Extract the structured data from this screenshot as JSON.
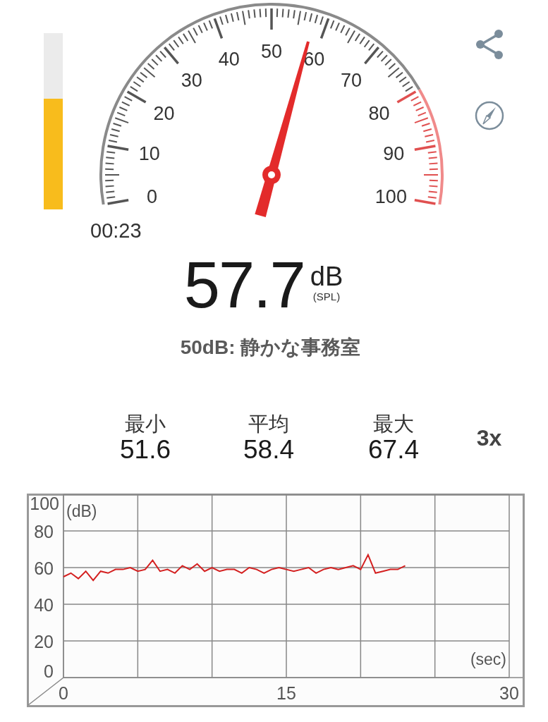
{
  "level_bar": {
    "level": 0.63
  },
  "gauge": {
    "scale_labels": [
      "50",
      "40",
      "60",
      "30",
      "70",
      "20",
      "80",
      "10",
      "90",
      "0",
      "100"
    ]
  },
  "timer": "00:23",
  "reading": {
    "value": "57.7",
    "unit": "dB",
    "weighting": "(SPL)"
  },
  "reference": "50dB: 静かな事務室",
  "stats": [
    {
      "label": "最小",
      "value": "51.6"
    },
    {
      "label": "平均",
      "value": "58.4"
    },
    {
      "label": "最大",
      "value": "67.4"
    }
  ],
  "zoom_button": "3x",
  "history": {
    "chart_data": {
      "type": "line",
      "grid": true,
      "xlabel": "(sec)",
      "ylabel": "(dB)",
      "xlim": [
        0,
        30
      ],
      "ylim": [
        0,
        100
      ],
      "xticks": [
        0,
        15,
        30
      ],
      "yticks": [
        0,
        20,
        40,
        60,
        80,
        100
      ],
      "x": [
        0,
        0.5,
        1,
        1.5,
        2,
        2.5,
        3,
        3.5,
        4,
        4.5,
        5,
        5.5,
        6,
        6.5,
        7,
        7.5,
        8,
        8.5,
        9,
        9.5,
        10,
        10.5,
        11,
        11.5,
        12,
        12.5,
        13,
        13.5,
        14,
        14.5,
        15,
        15.5,
        16,
        16.5,
        17,
        17.5,
        18,
        18.5,
        19,
        19.5,
        20,
        20.5,
        21,
        21.5,
        22,
        22.5,
        23
      ],
      "series": [
        {
          "color": "#d42020",
          "values": [
            55,
            57,
            54,
            58,
            53,
            58,
            57,
            59,
            59,
            60,
            58,
            59,
            64,
            58,
            59,
            57,
            61,
            59,
            62,
            58,
            60,
            58,
            59,
            59,
            57,
            60,
            59,
            57,
            59,
            60,
            59,
            58,
            59,
            60,
            57,
            59,
            60,
            59,
            60,
            61,
            59,
            67,
            57,
            58,
            59,
            59,
            61
          ]
        }
      ]
    }
  }
}
